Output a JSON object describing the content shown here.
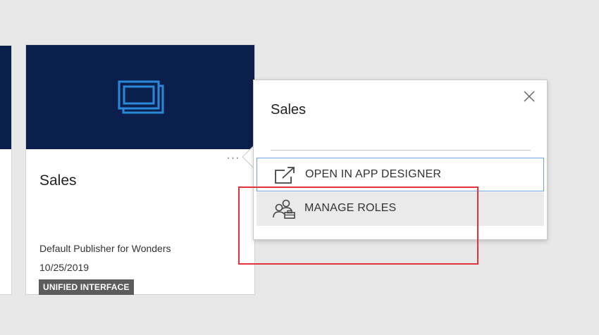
{
  "card": {
    "title": "Sales",
    "more_label": "···",
    "publisher": "Default Publisher for Wonders",
    "date": "10/25/2019",
    "badge": "UNIFIED INTERFACE",
    "hero_color": "#0b1f4d",
    "icon": "app-windows-icon"
  },
  "popup": {
    "title": "Sales",
    "close_icon": "close-icon",
    "items": [
      {
        "label": "OPEN IN APP DESIGNER",
        "icon": "open-external-icon"
      },
      {
        "label": "MANAGE ROLES",
        "icon": "manage-roles-icon"
      }
    ]
  },
  "colors": {
    "highlight": "#e0333c",
    "focus_border": "#6fa3e6",
    "icon_blue": "#2b88d8"
  }
}
